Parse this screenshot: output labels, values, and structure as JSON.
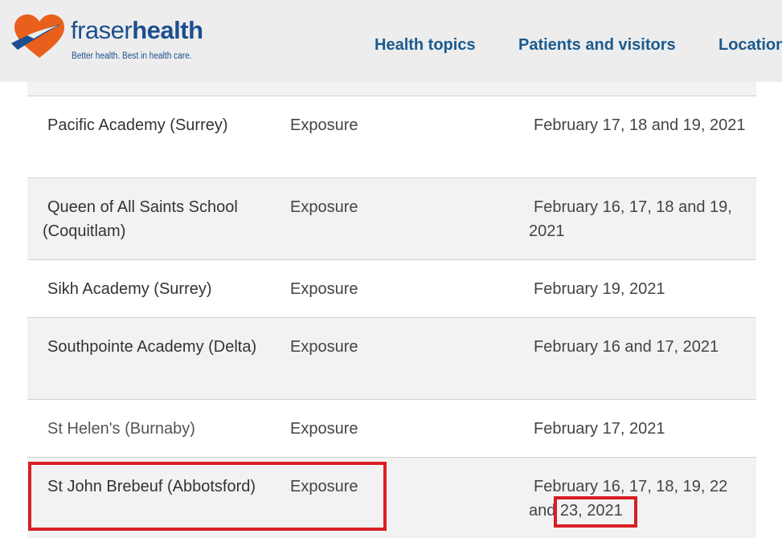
{
  "header": {
    "logo": {
      "word_part1": "fraser",
      "word_part2": "health",
      "tagline": "Better health. Best in health care."
    },
    "nav": [
      {
        "label": "Health topics"
      },
      {
        "label": "Patients and visitors"
      },
      {
        "label": "Locations"
      }
    ]
  },
  "table": {
    "rows": [
      {
        "name": "",
        "type": "",
        "date": ""
      },
      {
        "name": "Pacific Academy (Surrey)",
        "type": "Exposure",
        "date": "February 17, 18 and 19, 2021"
      },
      {
        "name": "Queen of All Saints School (Coquitlam)",
        "type": "Exposure",
        "date": "February 16, 17, 18 and 19, 2021"
      },
      {
        "name": "Sikh Academy (Surrey)",
        "type": "Exposure",
        "date": "February 19, 2021"
      },
      {
        "name": "Southpointe Academy (Delta)",
        "type": "Exposure",
        "date": "February 16 and 17, 2021"
      },
      {
        "name": "St Helen's (Burnaby)",
        "type": "Exposure",
        "date": "February 17, 2021"
      },
      {
        "name": "St John Brebeuf (Abbotsford)",
        "type": "Exposure",
        "date": "February 16, 17, 18, 19, 22 and 23, 2021"
      }
    ]
  },
  "colors": {
    "brand_blue": "#1b4f8e",
    "brand_orange": "#e8601c",
    "highlight_red": "#d71f26",
    "row_alt_bg": "#f2f2f2",
    "header_bg": "#ededed"
  },
  "icons": {
    "logo_mark": "heart-swoosh-icon"
  }
}
